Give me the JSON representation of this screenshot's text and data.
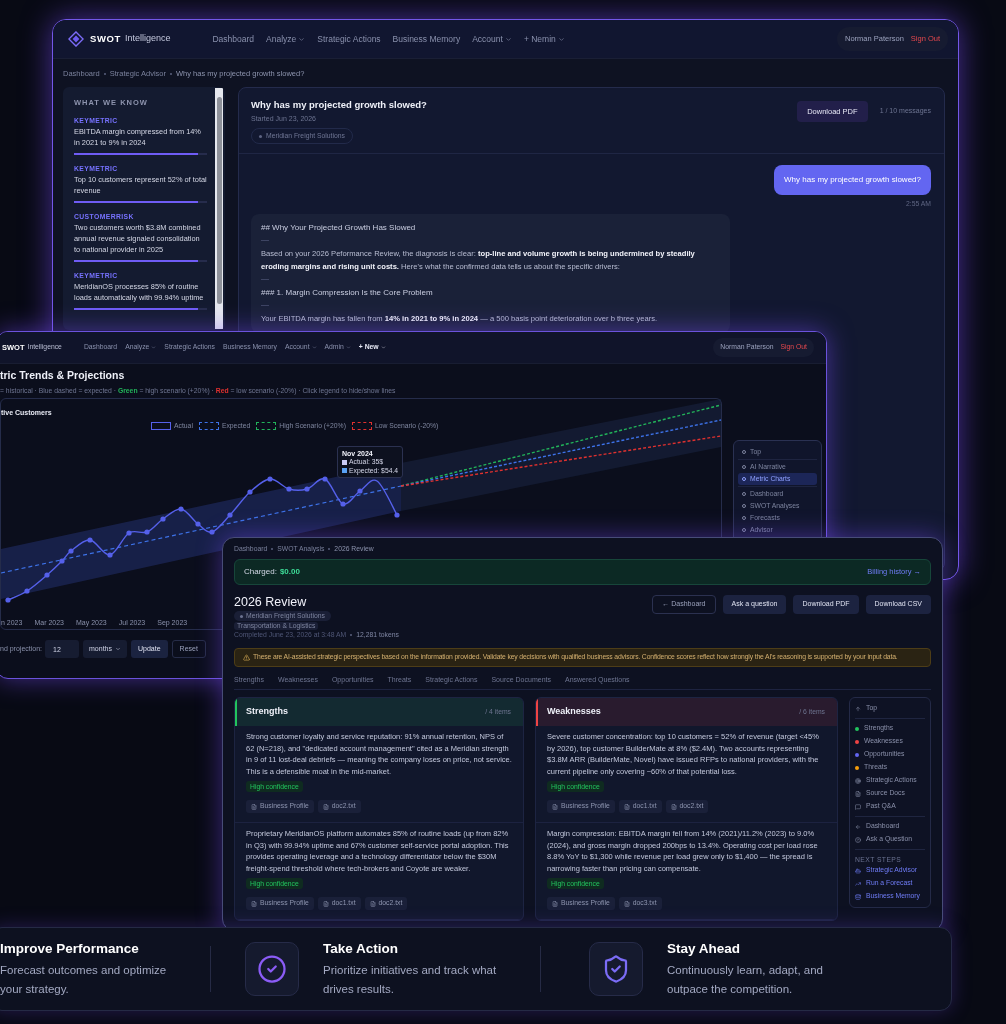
{
  "advisor_window": {
    "brand": {
      "name": "SWOT",
      "suffix": "Intelligence"
    },
    "nav": [
      {
        "label": "Dashboard",
        "dropdown": false
      },
      {
        "label": "Analyze",
        "dropdown": true
      },
      {
        "label": "Strategic Actions",
        "dropdown": false
      },
      {
        "label": "Business Memory",
        "dropdown": false
      },
      {
        "label": "Account",
        "dropdown": true
      },
      {
        "label": "+ Nemin",
        "dropdown": true
      }
    ],
    "user": {
      "name": "Norman Paterson",
      "action": "Sign Out"
    },
    "breadcrumb": [
      "Dashboard",
      "Strategic Advisor",
      "Why has my projected growth slowed?"
    ],
    "knowledge_panel": {
      "title": "WHAT WE KNOW",
      "items": [
        {
          "category": "KEYMETRIC",
          "text": "EBITDA margin compressed from 14% in 2021 to 9% in 2024",
          "level": 0.93
        },
        {
          "category": "KEYMETRIC",
          "text": "Top 10 customers represent 52% of total revenue",
          "level": 0.93
        },
        {
          "category": "CUSTOMERRISK",
          "text": "Two customers worth $3.8M combined annual revenue signaled consolidation to national provider in 2025",
          "level": 0.93
        },
        {
          "category": "KEYMETRIC",
          "text": "MeridianOS processes 85% of routine loads automatically with 99.94% uptime",
          "level": 0.93
        }
      ]
    },
    "conversation": {
      "title": "Why has my projected growth slowed?",
      "started": "Started Jun 23, 2026",
      "company": "Meridian Freight Solutions",
      "download_button": "Download PDF",
      "message_count": "1 / 10 messages",
      "messages": [
        {
          "kind": "user",
          "text": "Why has my projected growth slowed?",
          "time": "2:55 AM"
        },
        {
          "kind": "assistant",
          "blocks": [
            {
              "kind": "heading",
              "text": "## Why Your Projected Growth Has Slowed"
            },
            {
              "kind": "rule"
            },
            {
              "kind": "paragraph",
              "text": "Based on your 2026 Peformance Review, the diagnosis is clear: **top-line and volume growth is being undermined by steadily eroding margins and rising unit costs.** Here's what the confirmed data tells us about the specific drivers:"
            },
            {
              "kind": "rule"
            },
            {
              "kind": "heading",
              "text": "### 1. Margin Compression Is the Core Problem"
            },
            {
              "kind": "rule"
            },
            {
              "kind": "paragraph",
              "text": "Your EBITDA margin has fallen from **14% in 2021 to 9% in 2024** — a 500 basis point deterioration over b three years."
            }
          ]
        }
      ]
    }
  },
  "chart_window": {
    "brand": {
      "name": "SWOT",
      "suffix": "Intelligence"
    },
    "nav": [
      {
        "label": "Dashboard",
        "dropdown": false,
        "kind": "link"
      },
      {
        "label": "Analyze",
        "dropdown": true,
        "kind": "link"
      },
      {
        "label": "Strategic Actions",
        "dropdown": false,
        "kind": "link"
      },
      {
        "label": "Business Memory",
        "dropdown": false,
        "kind": "link"
      },
      {
        "label": "Account",
        "dropdown": true,
        "kind": "link"
      },
      {
        "label": "Admin",
        "dropdown": true,
        "kind": "link"
      },
      {
        "label": "+ New",
        "dropdown": true,
        "kind": "action"
      }
    ],
    "user": {
      "name": "Norman Paterson",
      "action": "Sign Out"
    },
    "title": "tric Trends & Projections",
    "description": [
      {
        "text": "= historical · Blue dashed = expected · ",
        "kind": "plain"
      },
      {
        "text": "Green",
        "kind": "high"
      },
      {
        "text": " = high scenario (+20%) · ",
        "kind": "plain"
      },
      {
        "text": "Red",
        "kind": "low"
      },
      {
        "text": " = low scenario (-20%) · Click legend to hide/show lines",
        "kind": "plain"
      }
    ],
    "chart": {
      "title": "tive Customers",
      "legend": [
        {
          "label": "Actual",
          "kind": "solid",
          "color": "#5560ea"
        },
        {
          "label": "Expected",
          "kind": "dashed",
          "color": "#3d72e8"
        },
        {
          "label": "High Scenario (+20%)",
          "kind": "dashed",
          "color": "#22b35a"
        },
        {
          "label": "Low Scenario (-20%)",
          "kind": "dashed",
          "color": "#e0312f"
        }
      ],
      "x_labels": [
        "n 2023",
        "Mar 2023",
        "May 2023",
        "Jul 2023",
        "Sep 2023"
      ],
      "tooltip": {
        "title": "Nov 2024",
        "entries": [
          {
            "text": "Actual: 35$",
            "color": "#c9cbf5"
          },
          {
            "text": "Expected: $54.4",
            "color": "#5aa2f5"
          }
        ]
      }
    },
    "section_nav": {
      "groups": [
        {
          "items": [
            {
              "label": "Top",
              "selected": false
            }
          ]
        },
        {
          "items": [
            {
              "label": "AI Narrative",
              "selected": false
            },
            {
              "label": "Metric Charts",
              "selected": true
            }
          ]
        },
        {
          "items": [
            {
              "label": "Dashboard",
              "selected": false
            },
            {
              "label": "SWOT Analyses",
              "selected": false
            },
            {
              "label": "Forecasts",
              "selected": false
            },
            {
              "label": "Advisor",
              "selected": false
            }
          ]
        }
      ]
    },
    "projection": {
      "label": "nd projection:",
      "value": "12",
      "unit": "months",
      "buttons": [
        {
          "label": "Update",
          "kind": "filled"
        },
        {
          "label": "Reset",
          "kind": "outline"
        }
      ]
    }
  },
  "review_window": {
    "breadcrumb": [
      "Dashboard",
      "SWOT Analysis",
      "2026 Review"
    ],
    "billing": {
      "label": "Charged:",
      "amount": "$0.00",
      "link": "Billing history →"
    },
    "title": "2026 Review",
    "actions": [
      {
        "label": "← Dashboard",
        "kind": "outline"
      },
      {
        "label": "Ask a question",
        "kind": "filled"
      },
      {
        "label": "Download PDF",
        "kind": "filled"
      },
      {
        "label": "Download CSV",
        "kind": "filled"
      }
    ],
    "tags": [
      {
        "label": "Meridian Freight Solutions",
        "kind": "company"
      },
      {
        "label": "Transportation & Logistics",
        "kind": "industry"
      }
    ],
    "completed": "Completed June 23, 2026 at 3:48 AM",
    "tokens": "12,281 tokens",
    "disclaimer": "These are AI-assisted strategic perspectives based on the information provided. Validate key decisions with qualified business advisors. Confidence scores reflect how strongly the AI's reasoning is supported by your input data.",
    "tabs": [
      {
        "label": "Strengths",
        "selected": false
      },
      {
        "label": "Weaknesses",
        "selected": false
      },
      {
        "label": "Opportunities",
        "selected": false
      },
      {
        "label": "Threats",
        "selected": false
      },
      {
        "label": "Strategic Actions",
        "selected": false
      },
      {
        "label": "Source Documents",
        "selected": false
      },
      {
        "label": "Answered Questions",
        "selected": false
      }
    ],
    "sections": [
      {
        "title": "Strengths",
        "count": "/ 4 items",
        "color": "#22c55e",
        "items": [
          {
            "text": "Strong customer loyalty and service reputation: 91% annual retention, NPS of 62 (N=218), and \"dedicated account management\" cited as a Meridian strength in 9 of 11 lost-deal debriefs — meaning the company loses on price, not service. This is a defensible moat in the mid-market.",
            "confidence": "High confidence",
            "sources": [
              "Business Profile",
              "doc2.txt"
            ]
          },
          {
            "text": "Proprietary MeridianOS platform automates 85% of routine loads (up from 82% in Q3) with 99.94% uptime and 67% customer self-service portal adoption. This provides operating leverage and a technology differentiator below the $30M freight-spend threshold where tech-brokers and Coyote are weaker.",
            "confidence": "High confidence",
            "sources": [
              "Business Profile",
              "doc1.txt",
              "doc2.txt"
            ]
          }
        ]
      },
      {
        "title": "Weaknesses",
        "count": "/ 6 items",
        "color": "#ef4444",
        "items": [
          {
            "text": "Severe customer concentration: top 10 customers = 52% of revenue (target <45% by 2026), top customer BuilderMate at 8% ($2.4M). Two accounts representing $3.8M ARR (BuilderMate, Novel) have issued RFPs to national providers, with the current pipeline only covering ~60% of that potential loss.",
            "confidence": "High confidence",
            "sources": [
              "Business Profile",
              "doc1.txt",
              "doc2.txt"
            ]
          },
          {
            "text": "Margin compression: EBITDA margin fell from 14% (2021)/11.2% (2023) to 9.0% (2024), and gross margin dropped 200bps to 13.4%. Operating cost per load rose 8.8% YoY to $1,300 while revenue per load grew only to $1,400 — the spread is narrowing faster than pricing can compensate.",
            "confidence": "High confidence",
            "sources": [
              "Business Profile",
              "doc3.txt"
            ]
          }
        ]
      }
    ],
    "section_nav": {
      "groups": [
        {
          "items": [
            {
              "label": "Top",
              "kind": "top"
            }
          ]
        },
        {
          "items": [
            {
              "label": "Strengths",
              "kind": "dot",
              "color": "#22c55e"
            },
            {
              "label": "Weaknesses",
              "kind": "dot",
              "color": "#ef4444"
            },
            {
              "label": "Opportunities",
              "kind": "dot",
              "color": "#6366f1"
            },
            {
              "label": "Threats",
              "kind": "dot",
              "color": "#f59e0b"
            },
            {
              "label": "Strategic Actions",
              "kind": "actions"
            },
            {
              "label": "Source Docs",
              "kind": "docs"
            },
            {
              "label": "Past Q&A",
              "kind": "qa"
            }
          ]
        },
        {
          "items": [
            {
              "label": "Dashboard",
              "kind": "back"
            },
            {
              "label": "Ask a Question",
              "kind": "ask"
            }
          ]
        }
      ],
      "next_steps": {
        "title": "NEXT STEPS",
        "items": [
          {
            "label": "Strategic Advisor",
            "kind": "advisor"
          },
          {
            "label": "Run a Forecast",
            "kind": "forecast"
          },
          {
            "label": "Business Memory",
            "kind": "memory"
          }
        ]
      }
    }
  },
  "feature_bar": {
    "features": [
      {
        "kind": "none",
        "title": "Improve Performance",
        "text": "Forecast outcomes and optimize your strategy."
      },
      {
        "kind": "check",
        "title": "Take Action",
        "text": "Prioritize initiatives and track what drives results."
      },
      {
        "kind": "shield",
        "title": "Stay Ahead",
        "text": "Continuously learn, adapt, and outpace the competition."
      }
    ]
  }
}
